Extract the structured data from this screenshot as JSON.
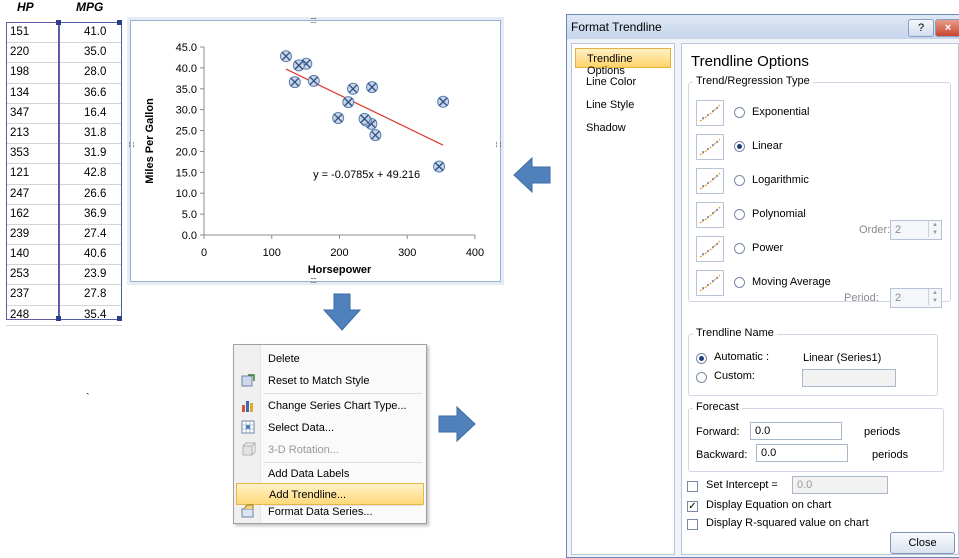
{
  "table": {
    "headers": [
      "HP",
      "MPG"
    ],
    "rows": [
      [
        "151",
        "41.0"
      ],
      [
        "220",
        "35.0"
      ],
      [
        "198",
        "28.0"
      ],
      [
        "134",
        "36.6"
      ],
      [
        "347",
        "16.4"
      ],
      [
        "213",
        "31.8"
      ],
      [
        "353",
        "31.9"
      ],
      [
        "121",
        "42.8"
      ],
      [
        "247",
        "26.6"
      ],
      [
        "162",
        "36.9"
      ],
      [
        "239",
        "27.4"
      ],
      [
        "140",
        "40.6"
      ],
      [
        "253",
        "23.9"
      ],
      [
        "237",
        "27.8"
      ],
      [
        "248",
        "35.4"
      ]
    ]
  },
  "chart_data": {
    "type": "scatter",
    "title": "",
    "xlabel": "Horsepower",
    "ylabel": "Miles Per Gallon",
    "xlim": [
      0,
      400
    ],
    "ylim": [
      0,
      45
    ],
    "x_ticks": [
      "0",
      "100",
      "200",
      "300",
      "400"
    ],
    "y_ticks": [
      "0.0",
      "5.0",
      "10.0",
      "15.0",
      "20.0",
      "25.0",
      "30.0",
      "35.0",
      "40.0",
      "45.0"
    ],
    "points": [
      [
        151,
        41.0
      ],
      [
        220,
        35.0
      ],
      [
        198,
        28.0
      ],
      [
        134,
        36.6
      ],
      [
        347,
        16.4
      ],
      [
        213,
        31.8
      ],
      [
        353,
        31.9
      ],
      [
        121,
        42.8
      ],
      [
        247,
        26.6
      ],
      [
        162,
        36.9
      ],
      [
        239,
        27.4
      ],
      [
        140,
        40.6
      ],
      [
        253,
        23.9
      ],
      [
        237,
        27.8
      ],
      [
        248,
        35.4
      ]
    ],
    "trendline": {
      "slope": -0.0785,
      "intercept": 49.216,
      "x_range": [
        121,
        353
      ],
      "label": "y = -0.0785x + 49.216",
      "color": "#e03a2c"
    },
    "grid": false,
    "legend": "none",
    "marker_color": "#5b7fb0"
  },
  "context_menu": {
    "items": [
      {
        "label": "Delete",
        "icon": "none",
        "disabled": false,
        "highlighted": false
      },
      {
        "label": "Reset to Match Style",
        "icon": "reset-style-icon",
        "disabled": false,
        "highlighted": false
      },
      {
        "label": "Change Series Chart Type...",
        "icon": "bar-chart-icon",
        "disabled": false,
        "highlighted": false
      },
      {
        "label": "Select Data...",
        "icon": "select-data-icon",
        "disabled": false,
        "highlighted": false
      },
      {
        "label": "3-D Rotation...",
        "icon": "rotation-3d-icon",
        "disabled": true,
        "highlighted": false
      },
      {
        "label": "Add Data Labels",
        "icon": "none",
        "disabled": false,
        "highlighted": false
      },
      {
        "label": "Add Trendline...",
        "icon": "none",
        "disabled": false,
        "highlighted": true
      },
      {
        "label": "Format Data Series...",
        "icon": "format-series-icon",
        "disabled": false,
        "highlighted": false
      }
    ]
  },
  "dialog": {
    "title": "Format Trendline",
    "help_button": "?",
    "close_button_glyph": "×",
    "nav": [
      "Trendline Options",
      "Line Color",
      "Line Style",
      "Shadow"
    ],
    "heading": "Trendline Options",
    "type_group_label": "Trend/Regression Type",
    "types": [
      {
        "label": "Exponential",
        "selected": false
      },
      {
        "label": "Linear",
        "selected": true
      },
      {
        "label": "Logarithmic",
        "selected": false
      },
      {
        "label": "Polynomial",
        "selected": false
      },
      {
        "label": "Power",
        "selected": false
      },
      {
        "label": "Moving Average",
        "selected": false
      }
    ],
    "order_label": "Order:",
    "order_value": "2",
    "period_label": "Period:",
    "period_value": "2",
    "name_group_label": "Trendline Name",
    "automatic_label": "Automatic :",
    "automatic_value": "Linear (Series1)",
    "custom_label": "Custom:",
    "forecast_group_label": "Forecast",
    "forward_label": "Forward:",
    "forward_value": "0.0",
    "backward_label": "Backward:",
    "backward_value": "0.0",
    "periods_label": "periods",
    "set_intercept_label": "Set Intercept =",
    "set_intercept_value": "0.0",
    "display_equation_label": "Display Equation on chart",
    "display_r2_label": "Display R-squared value on chart",
    "close_label": "Close"
  },
  "arrow_color": "#4f81bd"
}
